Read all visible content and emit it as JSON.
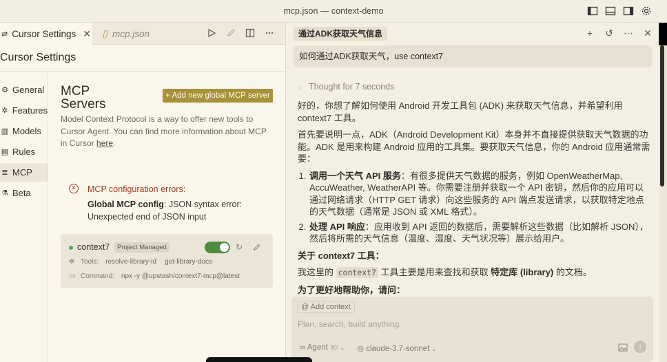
{
  "window": {
    "title": "mcp.json — context-demo"
  },
  "editor": {
    "tabs": [
      {
        "label": "Cursor Settings"
      },
      {
        "label": "mcp.json"
      }
    ],
    "settings_heading": "Cursor Settings",
    "nav": [
      {
        "label": "General",
        "icon": "gear-icon"
      },
      {
        "label": "Features",
        "icon": "wrench-icon"
      },
      {
        "label": "Models",
        "icon": "bar-chart-icon"
      },
      {
        "label": "Rules",
        "icon": "document-icon"
      },
      {
        "label": "MCP",
        "icon": "server-icon",
        "selected": true
      },
      {
        "label": "Beta",
        "icon": "flask-icon"
      }
    ],
    "mcp": {
      "title_line1": "MCP",
      "title_line2": "Servers",
      "add_button": "+ Add new global MCP server",
      "description": "Model Context Protocol is a way to offer new tools to Cursor Agent. You can find more information about MCP in Cursor ",
      "description_link": "here",
      "description_end": ".",
      "error_title": "MCP configuration errors:",
      "error_bold": "Global MCP config",
      "error_text": ": JSON syntax error: Unexpected end of JSON input",
      "server": {
        "name": "context7",
        "badge": "Project Managed",
        "enabled": true,
        "tools_label": "Tools:",
        "tools": [
          "resolve-library-id",
          "get-library-docs"
        ],
        "command_label": "Command:",
        "command": "npx -y @upstash/context7-mcp@latest"
      }
    }
  },
  "chat": {
    "tab_title": "通过ADK获取天气信息",
    "user_message": "如何通过ADK获取天气，use context7",
    "thought": "Thought for 7 seconds",
    "p1": "好的，你想了解如何使用 Android 开发工具包 (ADK) 来获取天气信息，并希望利用 context7 工具。",
    "p2": "首先要说明一点，ADK（Android Development Kit）本身并不直接提供获取天气数据的功能。ADK 是用来构建 Android 应用的工具集。要获取天气信息，你的 Android 应用通常需要：",
    "item1_bold": "调用一个天气 API 服务",
    "item1_text": "：有很多提供天气数据的服务，例如 OpenWeatherMap, AccuWeather, WeatherAPI 等。你需要注册并获取一个 API 密钥，然后你的应用可以通过网络请求（HTTP GET 请求）向这些服务的 API 端点发送请求，以获取特定地点的天气数据（通常是 JSON 或 XML 格式）。",
    "item2_bold": "处理 API 响应",
    "item2_text": "：应用收到 API 返回的数据后，需要解析这些数据（比如解析 JSON），然后将所需的天气信息（温度、湿度、天气状况等）展示给用户。",
    "about_heading": "关于 context7 工具：",
    "about_pre": "我这里的 ",
    "about_code": "context7",
    "about_mid": " 工具主要是用来查找和获取 ",
    "about_bold": "特定库 (library)",
    "about_post": " 的文档。",
    "help_heading": "为了更好地帮助你，请问：",
    "composer": {
      "add_context": "Add context",
      "placeholder": "Plan, search, build anything",
      "agent": "Agent",
      "agent_shortcut": "⌘I",
      "model": "claude-3.7-sonnet"
    }
  }
}
